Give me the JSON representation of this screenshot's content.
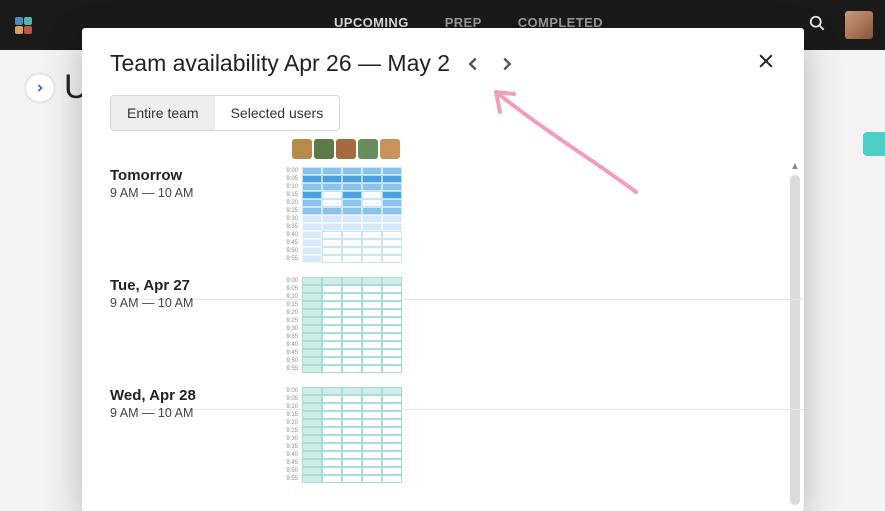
{
  "topbar": {
    "nav": [
      "UPCOMING",
      "PREP",
      "COMPLETED"
    ],
    "logo_colors": [
      "#4e8db3",
      "#57b6ac",
      "#d99e5f",
      "#b85a4a"
    ]
  },
  "background": {
    "title_partial": "Up"
  },
  "modal": {
    "title": "Team availability Apr 26 — May 2",
    "filters": {
      "entire": "Entire team",
      "selected": "Selected users"
    },
    "user_colors": [
      "#b88a4a",
      "#5d7b46",
      "#a56a3d",
      "#6a8d5e",
      "#c79359"
    ],
    "times": [
      "9:00",
      "9:05",
      "9:10",
      "9:15",
      "9:20",
      "9:25",
      "9:30",
      "9:35",
      "9:40",
      "9:45",
      "9:50",
      "9:55"
    ],
    "days": [
      {
        "title": "Tomorrow",
        "time": "9 AM — 10 AM",
        "style": "blue"
      },
      {
        "title": "Tue, Apr 27",
        "time": "9 AM — 10 AM",
        "style": "teal"
      },
      {
        "title": "Wed, Apr 28",
        "time": "9 AM — 10 AM",
        "style": "teal"
      }
    ]
  }
}
